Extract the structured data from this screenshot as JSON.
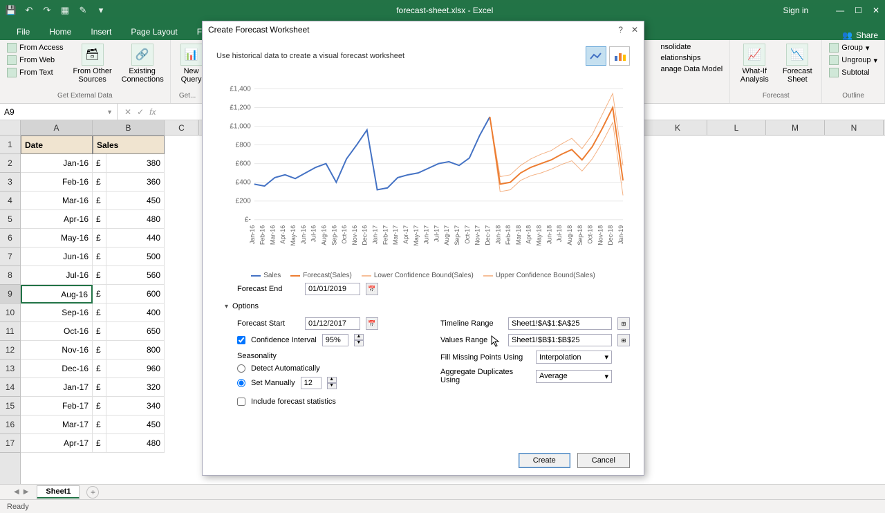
{
  "app": {
    "title": "forecast-sheet.xlsx - Excel",
    "signin": "Sign in",
    "share": "Share"
  },
  "tabs": [
    "File",
    "Home",
    "Insert",
    "Page Layout",
    "Fo..."
  ],
  "ribbon": {
    "external_data": {
      "from_access": "From Access",
      "from_web": "From Web",
      "from_text": "From Text",
      "from_other": "From Other Sources",
      "existing": "Existing Connections",
      "label": "Get External Data"
    },
    "get_transform": {
      "new_query": "New Query",
      "label": "Get..."
    },
    "data_tools": {
      "consolidate": "nsolidate",
      "relationships": "elationships",
      "manage": "anage Data Model"
    },
    "forecast": {
      "whatif": "What-If Analysis",
      "sheet": "Forecast Sheet",
      "label": "Forecast"
    },
    "outline": {
      "group": "Group",
      "ungroup": "Ungroup",
      "subtotal": "Subtotal",
      "label": "Outline"
    }
  },
  "namebox": "A9",
  "columns": [
    "A",
    "B",
    "C",
    "K",
    "L",
    "M",
    "N"
  ],
  "headers": {
    "date": "Date",
    "sales": "Sales"
  },
  "rows": [
    {
      "date": "Jan-16",
      "cur": "£",
      "val": "380"
    },
    {
      "date": "Feb-16",
      "cur": "£",
      "val": "360"
    },
    {
      "date": "Mar-16",
      "cur": "£",
      "val": "450"
    },
    {
      "date": "Apr-16",
      "cur": "£",
      "val": "480"
    },
    {
      "date": "May-16",
      "cur": "£",
      "val": "440"
    },
    {
      "date": "Jun-16",
      "cur": "£",
      "val": "500"
    },
    {
      "date": "Jul-16",
      "cur": "£",
      "val": "560"
    },
    {
      "date": "Aug-16",
      "cur": "£",
      "val": "600"
    },
    {
      "date": "Sep-16",
      "cur": "£",
      "val": "400"
    },
    {
      "date": "Oct-16",
      "cur": "£",
      "val": "650"
    },
    {
      "date": "Nov-16",
      "cur": "£",
      "val": "800"
    },
    {
      "date": "Dec-16",
      "cur": "£",
      "val": "960"
    },
    {
      "date": "Jan-17",
      "cur": "£",
      "val": "320"
    },
    {
      "date": "Feb-17",
      "cur": "£",
      "val": "340"
    },
    {
      "date": "Mar-17",
      "cur": "£",
      "val": "450"
    },
    {
      "date": "Apr-17",
      "cur": "£",
      "val": "480"
    }
  ],
  "sheet_tab": "Sheet1",
  "status": "Ready",
  "dialog": {
    "title": "Create Forecast Worksheet",
    "desc": "Use historical data to create a visual forecast worksheet",
    "forecast_end_label": "Forecast End",
    "forecast_end": "01/01/2019",
    "options": "Options",
    "forecast_start_label": "Forecast Start",
    "forecast_start": "01/12/2017",
    "confidence_label": "Confidence Interval",
    "confidence": "95%",
    "seasonality_label": "Seasonality",
    "detect_auto": "Detect Automatically",
    "set_manual": "Set Manually",
    "manual_val": "12",
    "include_stats": "Include forecast statistics",
    "timeline_label": "Timeline Range",
    "timeline": "Sheet1!$A$1:$A$25",
    "values_label": "Values Range",
    "values": "Sheet1!$B$1:$B$25",
    "fill_label": "Fill Missing Points Using",
    "fill": "Interpolation",
    "aggregate_label": "Aggregate Duplicates Using",
    "aggregate": "Average",
    "create": "Create",
    "cancel": "Cancel",
    "legend": {
      "sales": "Sales",
      "forecast": "Forecast(Sales)",
      "lower": "Lower Confidence Bound(Sales)",
      "upper": "Upper Confidence Bound(Sales)"
    }
  },
  "chart_data": {
    "type": "line",
    "ylabel": "",
    "xlabel": "",
    "yticks": [
      "£-",
      "£200",
      "£400",
      "£600",
      "£800",
      "£1,000",
      "£1,200",
      "£1,400"
    ],
    "ylim": [
      0,
      1400
    ],
    "categories": [
      "Jan-16",
      "Feb-16",
      "Mar-16",
      "Apr-16",
      "May-16",
      "Jun-16",
      "Jul-16",
      "Aug-16",
      "Sep-16",
      "Oct-16",
      "Nov-16",
      "Dec-16",
      "Jan-17",
      "Feb-17",
      "Mar-17",
      "Apr-17",
      "May-17",
      "Jun-17",
      "Jul-17",
      "Aug-17",
      "Sep-17",
      "Oct-17",
      "Nov-17",
      "Dec-17",
      "Jan-18",
      "Feb-18",
      "Mar-18",
      "Apr-18",
      "May-18",
      "Jun-18",
      "Jul-18",
      "Aug-18",
      "Sep-18",
      "Oct-18",
      "Nov-18",
      "Dec-18",
      "Jan-19"
    ],
    "series": [
      {
        "name": "Sales",
        "color": "#4472c4",
        "values": [
          380,
          360,
          450,
          480,
          440,
          500,
          560,
          600,
          400,
          650,
          800,
          960,
          320,
          340,
          450,
          480,
          500,
          550,
          600,
          620,
          580,
          660,
          900,
          1100,
          null,
          null,
          null,
          null,
          null,
          null,
          null,
          null,
          null,
          null,
          null,
          null,
          null
        ]
      },
      {
        "name": "Forecast(Sales)",
        "color": "#ed7d31",
        "values": [
          null,
          null,
          null,
          null,
          null,
          null,
          null,
          null,
          null,
          null,
          null,
          null,
          null,
          null,
          null,
          null,
          null,
          null,
          null,
          null,
          null,
          null,
          null,
          1100,
          380,
          400,
          500,
          560,
          600,
          640,
          700,
          750,
          640,
          780,
          980,
          1200,
          420
        ]
      },
      {
        "name": "Lower Confidence Bound(Sales)",
        "color": "#ed7d31",
        "style": "thin",
        "values": [
          null,
          null,
          null,
          null,
          null,
          null,
          null,
          null,
          null,
          null,
          null,
          null,
          null,
          null,
          null,
          null,
          null,
          null,
          null,
          null,
          null,
          null,
          null,
          1100,
          300,
          320,
          420,
          470,
          500,
          540,
          590,
          630,
          520,
          650,
          830,
          1040,
          260
        ]
      },
      {
        "name": "Upper Confidence Bound(Sales)",
        "color": "#ed7d31",
        "style": "thin",
        "values": [
          null,
          null,
          null,
          null,
          null,
          null,
          null,
          null,
          null,
          null,
          null,
          null,
          null,
          null,
          null,
          null,
          null,
          null,
          null,
          null,
          null,
          null,
          null,
          1100,
          460,
          480,
          580,
          650,
          700,
          740,
          810,
          870,
          760,
          910,
          1130,
          1350,
          580
        ]
      }
    ]
  }
}
